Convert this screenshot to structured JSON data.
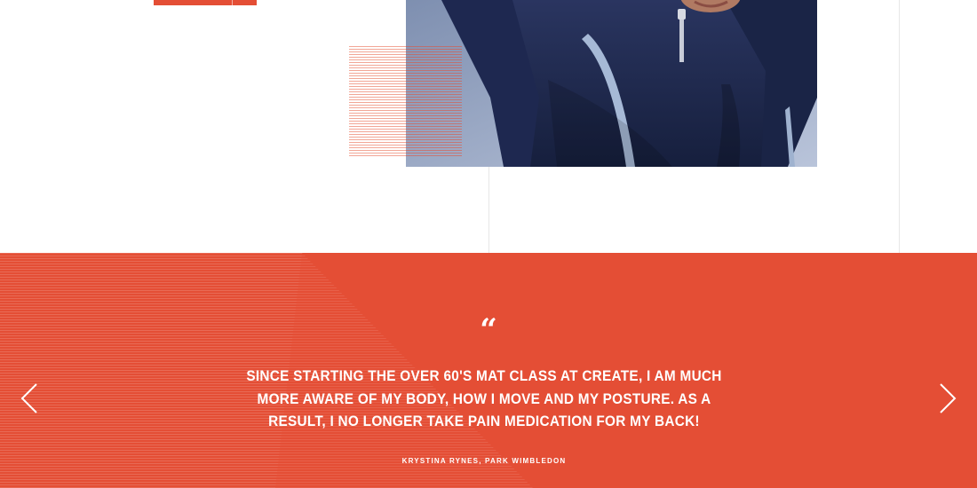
{
  "hero": {
    "photo_alt": "woman in navy jacket"
  },
  "testimonial": {
    "quote_mark": "“",
    "quote": "SINCE STARTING THE OVER 60'S MAT CLASS AT CREATE, I AM MUCH MORE AWARE OF MY BODY, HOW I MOVE AND MY POSTURE. AS A RESULT, I NO LONGER TAKE PAIN MEDICATION FOR MY BACK!",
    "author": "KRYSTINA RYNES, PARK WIMBLEDON"
  },
  "colors": {
    "accent": "#e44e35",
    "white": "#ffffff",
    "jacket_navy": "#1b2547"
  },
  "icons": {
    "prev": "chevron-left-icon",
    "next": "chevron-right-icon"
  }
}
